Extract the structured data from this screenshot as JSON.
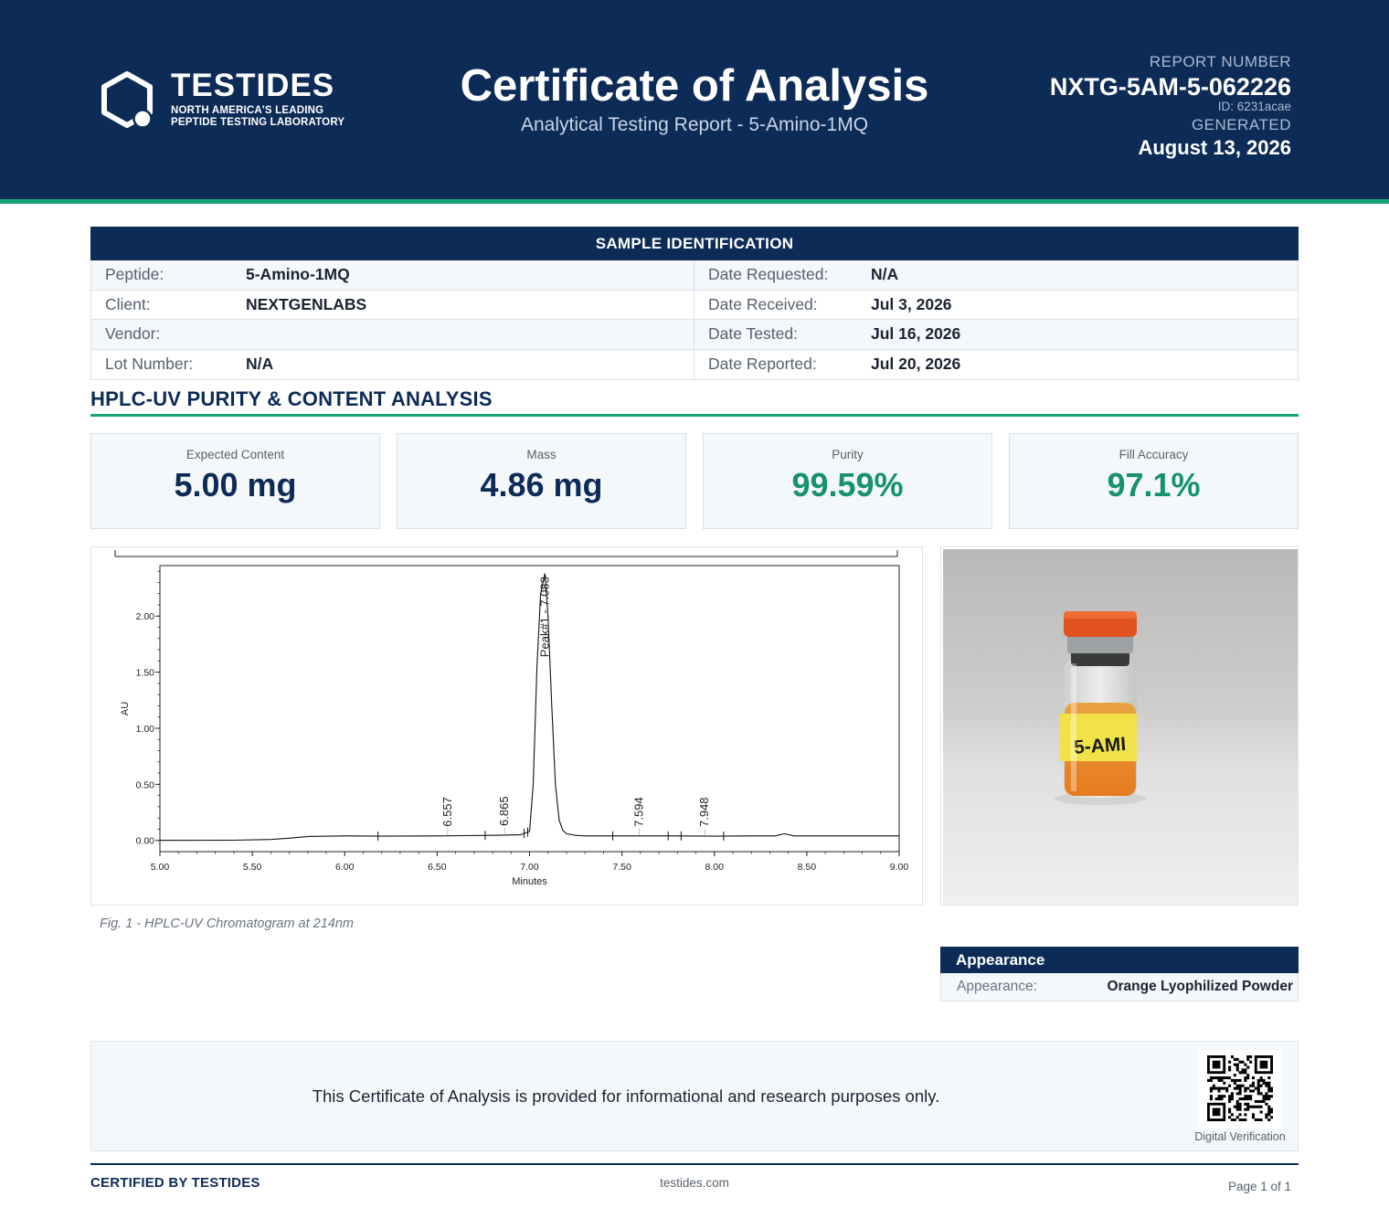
{
  "header": {
    "brand": "TESTIDES",
    "tagline_line1": "NORTH AMERICA'S LEADING",
    "tagline_line2": "PEPTIDE TESTING LABORATORY",
    "title": "Certificate of Analysis",
    "subtitle": "Analytical Testing Report  -  5-Amino-1MQ",
    "report_label": "REPORT NUMBER",
    "report_number": "NXTG-5AM-5-062226",
    "report_id": "ID: 6231acae",
    "generated_label": "GENERATED",
    "generated_date": "August 13, 2026",
    "colors": {
      "navy": "#0d2b57",
      "accent_green": "#16a37a"
    }
  },
  "sample": {
    "heading": "SAMPLE IDENTIFICATION",
    "rows": [
      {
        "left_label": "Peptide:",
        "left_value": "5-Amino-1MQ",
        "right_label": "Date Requested:",
        "right_value": "N/A"
      },
      {
        "left_label": "Client:",
        "left_value": "NEXTGENLABS",
        "right_label": "Date Received:",
        "right_value": "Jul 3, 2026"
      },
      {
        "left_label": "Vendor:",
        "left_value": "",
        "right_label": "Date Tested:",
        "right_value": "Jul 16, 2026"
      },
      {
        "left_label": "Lot Number:",
        "left_value": "N/A",
        "right_label": "Date Reported:",
        "right_value": "Jul 20, 2026"
      }
    ]
  },
  "analysis": {
    "section_title": "HPLC-UV PURITY & CONTENT ANALYSIS",
    "metrics": [
      {
        "label": "Expected Content",
        "value": "5.00 mg",
        "color": "#0d2b57"
      },
      {
        "label": "Mass",
        "value": "4.86 mg",
        "color": "#0d2b57"
      },
      {
        "label": "Purity",
        "value": "99.59%",
        "color": "#16926d"
      },
      {
        "label": "Fill Accuracy",
        "value": "97.1%",
        "color": "#16926d"
      }
    ]
  },
  "chart_data": {
    "type": "line",
    "title": "",
    "xlabel": "Minutes",
    "ylabel": "AU",
    "xlim": [
      5.0,
      9.0
    ],
    "ylim": [
      -0.1,
      2.45
    ],
    "x_ticks": [
      "5.00",
      "5.50",
      "6.00",
      "6.50",
      "7.00",
      "7.50",
      "8.00",
      "8.50",
      "9.00"
    ],
    "y_ticks": [
      "0.00",
      "0.50",
      "1.00",
      "1.50",
      "2.00"
    ],
    "grid": false,
    "series": [
      {
        "x": [
          5.0,
          5.4,
          5.6,
          5.7,
          5.8,
          6.0,
          6.2,
          6.5,
          6.8,
          6.95,
          7.0,
          7.02,
          7.04,
          7.06,
          7.083,
          7.1,
          7.12,
          7.14,
          7.16,
          7.18,
          7.2,
          7.25,
          7.3,
          7.5,
          7.8,
          8.0,
          8.2,
          8.33,
          8.38,
          8.43,
          8.5,
          9.0
        ],
        "y": [
          0.0,
          0.002,
          0.008,
          0.02,
          0.035,
          0.04,
          0.038,
          0.04,
          0.045,
          0.05,
          0.08,
          0.5,
          1.55,
          2.2,
          2.38,
          2.0,
          1.2,
          0.5,
          0.18,
          0.09,
          0.06,
          0.045,
          0.04,
          0.04,
          0.04,
          0.038,
          0.04,
          0.04,
          0.06,
          0.04,
          0.04,
          0.04
        ]
      }
    ],
    "peaks": [
      {
        "rt": 6.557,
        "label": "6.557"
      },
      {
        "rt": 6.865,
        "label": "6.865"
      },
      {
        "rt": 7.083,
        "label": "Peak#1 - 7.083"
      },
      {
        "rt": 7.594,
        "label": "7.594"
      },
      {
        "rt": 7.948,
        "label": "7.948"
      }
    ],
    "integration_marks": [
      6.18,
      6.76,
      6.97,
      6.99,
      7.45,
      7.75,
      7.82,
      8.05
    ]
  },
  "figure": {
    "caption": "Fig. 1  -  HPLC-UV Chromatogram at 214nm"
  },
  "photo": {
    "vial_label": "5-AMI"
  },
  "appearance": {
    "heading": "Appearance",
    "label": "Appearance:",
    "value": "Orange Lyophilized Powder"
  },
  "disclaimer": {
    "text": "This Certificate of Analysis is provided for informational and research purposes only.",
    "qr_caption": "Digital Verification"
  },
  "footer": {
    "certified": "CERTIFIED BY TESTIDES",
    "website": "testides.com",
    "page": "Page 1 of 1"
  }
}
